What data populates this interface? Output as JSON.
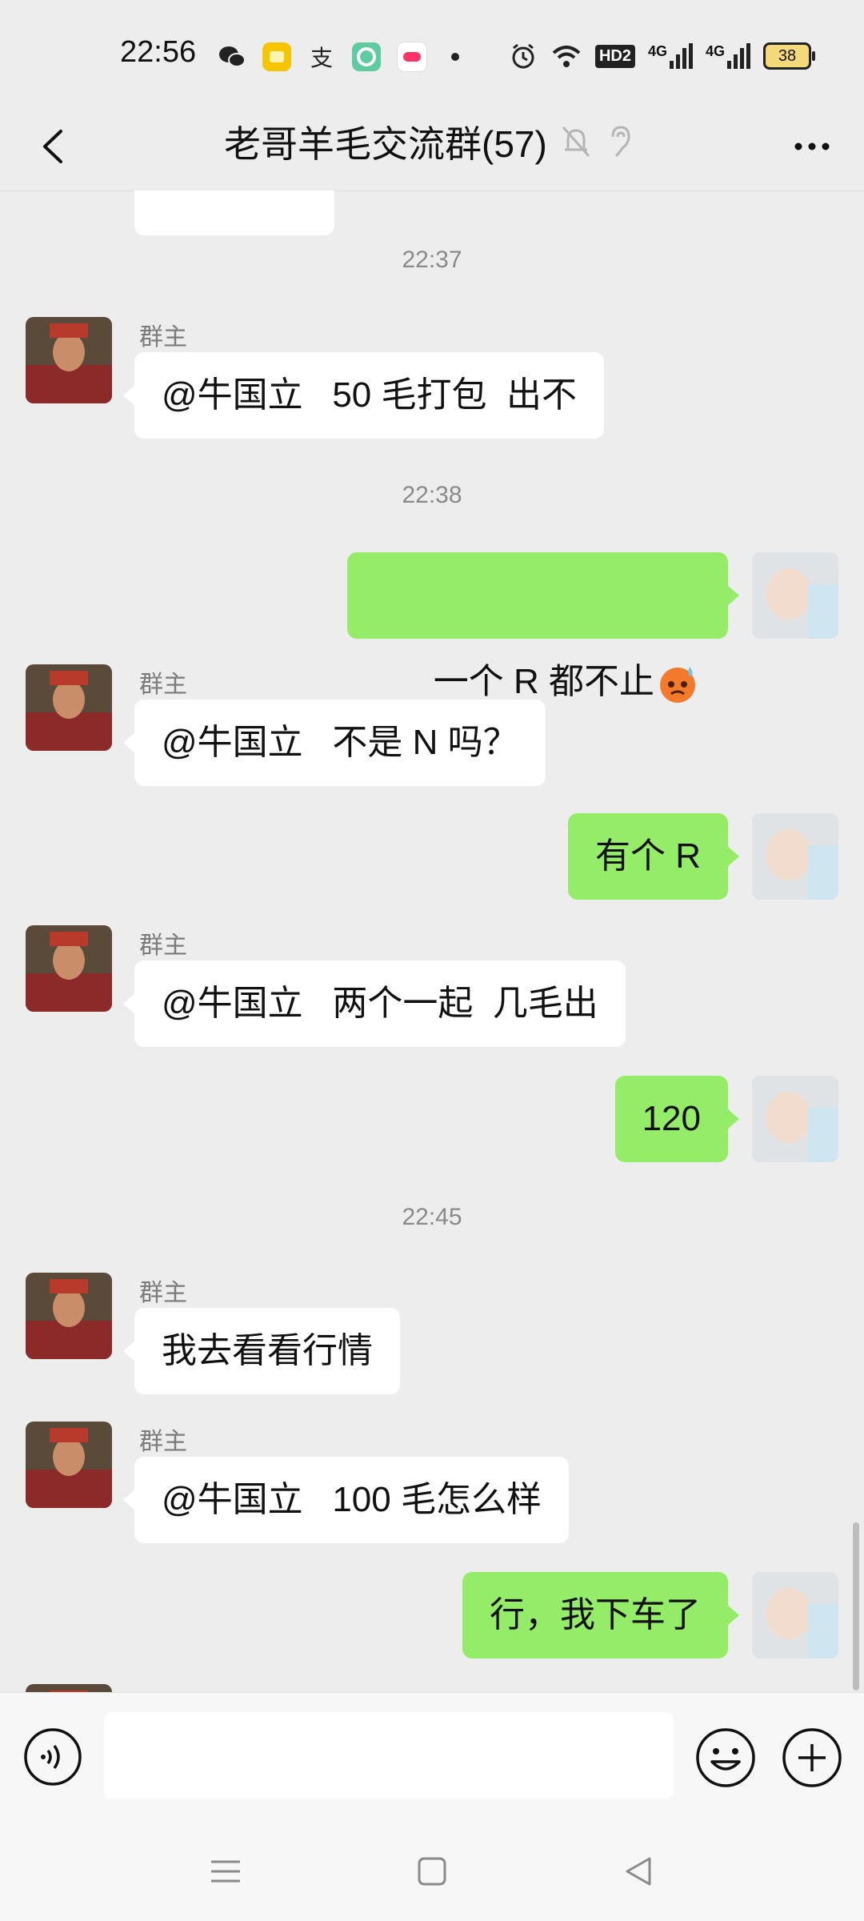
{
  "status_bar": {
    "time": "22:56",
    "battery": "38",
    "network_label": "HD2",
    "signal_1": "4G",
    "signal_2": "4G",
    "app_icons": [
      "wechat-icon",
      "notes-icon",
      "alipay-icon",
      "app-green-icon",
      "game-icon"
    ]
  },
  "header": {
    "title": "老哥羊毛交流群(57)",
    "muted": true,
    "earpiece": true
  },
  "messages": {
    "ts1": "22:37",
    "m1": {
      "sender": "群主",
      "text": "@牛国立   50 毛打包  出不"
    },
    "ts2": "22:38",
    "m2": {
      "text": "一个 R 都不止"
    },
    "m3": {
      "sender": "群主",
      "text": "@牛国立   不是 N 吗？"
    },
    "m4": {
      "text": "有个 R"
    },
    "m5": {
      "sender": "群主",
      "text": "@牛国立   两个一起  几毛出"
    },
    "m6": {
      "text": "120"
    },
    "ts3": "22:45",
    "m7": {
      "sender": "群主",
      "text": "我去看看行情"
    },
    "m8": {
      "sender": "群主",
      "text": "@牛国立   100 毛怎么样"
    },
    "m9": {
      "text": "行，我下车了"
    }
  },
  "input": {
    "value": "",
    "placeholder": ""
  },
  "colors": {
    "background": "#ededed",
    "outgoing_bubble": "#95ec69",
    "incoming_bubble": "#ffffff"
  }
}
